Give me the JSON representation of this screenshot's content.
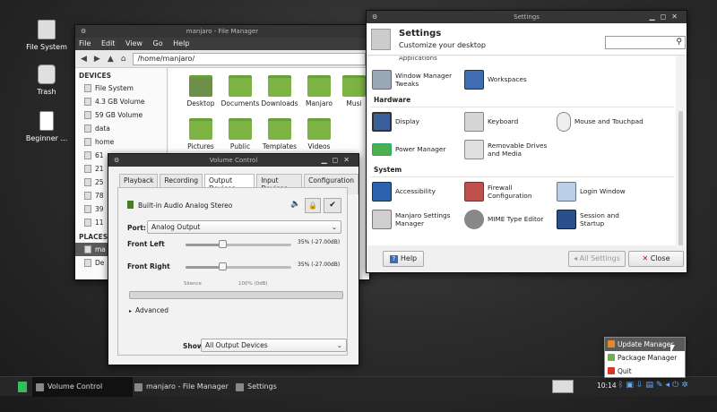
{
  "desktop": {
    "icons": [
      {
        "label": "File System"
      },
      {
        "label": "Trash"
      },
      {
        "label": "Beginner ..."
      }
    ]
  },
  "file_manager": {
    "title": "manjaro - File Manager",
    "menu": [
      "File",
      "Edit",
      "View",
      "Go",
      "Help"
    ],
    "path": "/home/manjaro/",
    "devices_header": "DEVICES",
    "devices": [
      "File System",
      "4.3 GB Volume",
      "59 GB Volume",
      "data",
      "home",
      "61",
      "21",
      "25",
      "78",
      "39",
      "11"
    ],
    "places_header": "PLACES",
    "places": [
      "ma",
      "De"
    ],
    "folders": [
      "Desktop",
      "Documents",
      "Downloads",
      "Manjaro",
      "Musi",
      "Pictures",
      "Public",
      "Templates",
      "Videos"
    ]
  },
  "settings": {
    "window_title": "Settings",
    "title": "Settings",
    "subtitle": "Customize your desktop",
    "search_placeholder": "",
    "cut_label": "Applications",
    "row1": [
      "Window Manager Tweaks",
      "Workspaces"
    ],
    "hardware_header": "Hardware",
    "row2": [
      "Display",
      "Keyboard",
      "Mouse and Touchpad"
    ],
    "row3": [
      "Power Manager",
      "Removable Drives and Media"
    ],
    "system_header": "System",
    "row4": [
      "Accessibility",
      "Firewall Configuration",
      "Login Window"
    ],
    "row5": [
      "Manjaro Settings Manager",
      "MIME Type Editor",
      "Session and Startup"
    ],
    "help": "Help",
    "all_settings": "All Settings",
    "close": "Close"
  },
  "volume": {
    "title": "Volume Control",
    "tabs": [
      "Playback",
      "Recording",
      "Output Devices",
      "Input Devices",
      "Configuration"
    ],
    "device": "Built-in Audio Analog Stereo",
    "port_label": "Port:",
    "port_value": "Analog Output",
    "front_left": "Front Left",
    "front_left_value": "35% (-27.00dB)",
    "front_right": "Front Right",
    "front_right_value": "35% (-27.00dB)",
    "silence": "Silence",
    "hundred": "100% (0dB)",
    "advanced": "Advanced",
    "show_label": "Show:",
    "show_value": "All Output Devices",
    "level_fraction": 0.35
  },
  "taskbar": {
    "tasks": [
      "Volume Control",
      "manjaro - File Manager",
      "Settings"
    ],
    "clock": "10:14"
  },
  "tray_menu": {
    "items": [
      "Update Manager",
      "Package Manager",
      "Quit"
    ]
  }
}
